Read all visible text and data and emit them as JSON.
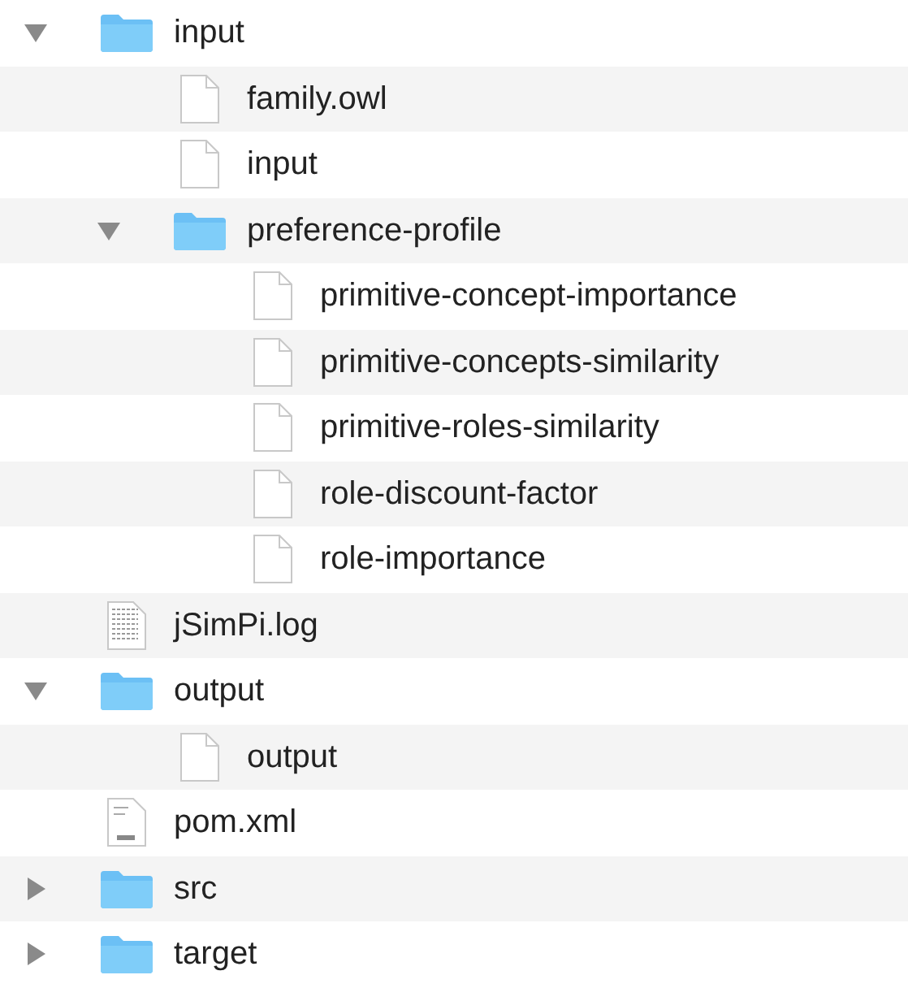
{
  "tree": [
    {
      "name": "input",
      "kind": "folder",
      "expanded": true,
      "children": [
        {
          "name": "family.owl",
          "kind": "file"
        },
        {
          "name": "input",
          "kind": "file"
        },
        {
          "name": "preference-profile",
          "kind": "folder",
          "expanded": true,
          "children": [
            {
              "name": "primitive-concept-importance",
              "kind": "file"
            },
            {
              "name": "primitive-concepts-similarity",
              "kind": "file"
            },
            {
              "name": "primitive-roles-similarity",
              "kind": "file"
            },
            {
              "name": "role-discount-factor",
              "kind": "file"
            },
            {
              "name": "role-importance",
              "kind": "file"
            }
          ]
        }
      ]
    },
    {
      "name": "jSimPi.log",
      "kind": "log"
    },
    {
      "name": "output",
      "kind": "folder",
      "expanded": true,
      "children": [
        {
          "name": "output",
          "kind": "file"
        }
      ]
    },
    {
      "name": "pom.xml",
      "kind": "xml"
    },
    {
      "name": "src",
      "kind": "folder",
      "expanded": false
    },
    {
      "name": "target",
      "kind": "folder",
      "expanded": false
    }
  ]
}
